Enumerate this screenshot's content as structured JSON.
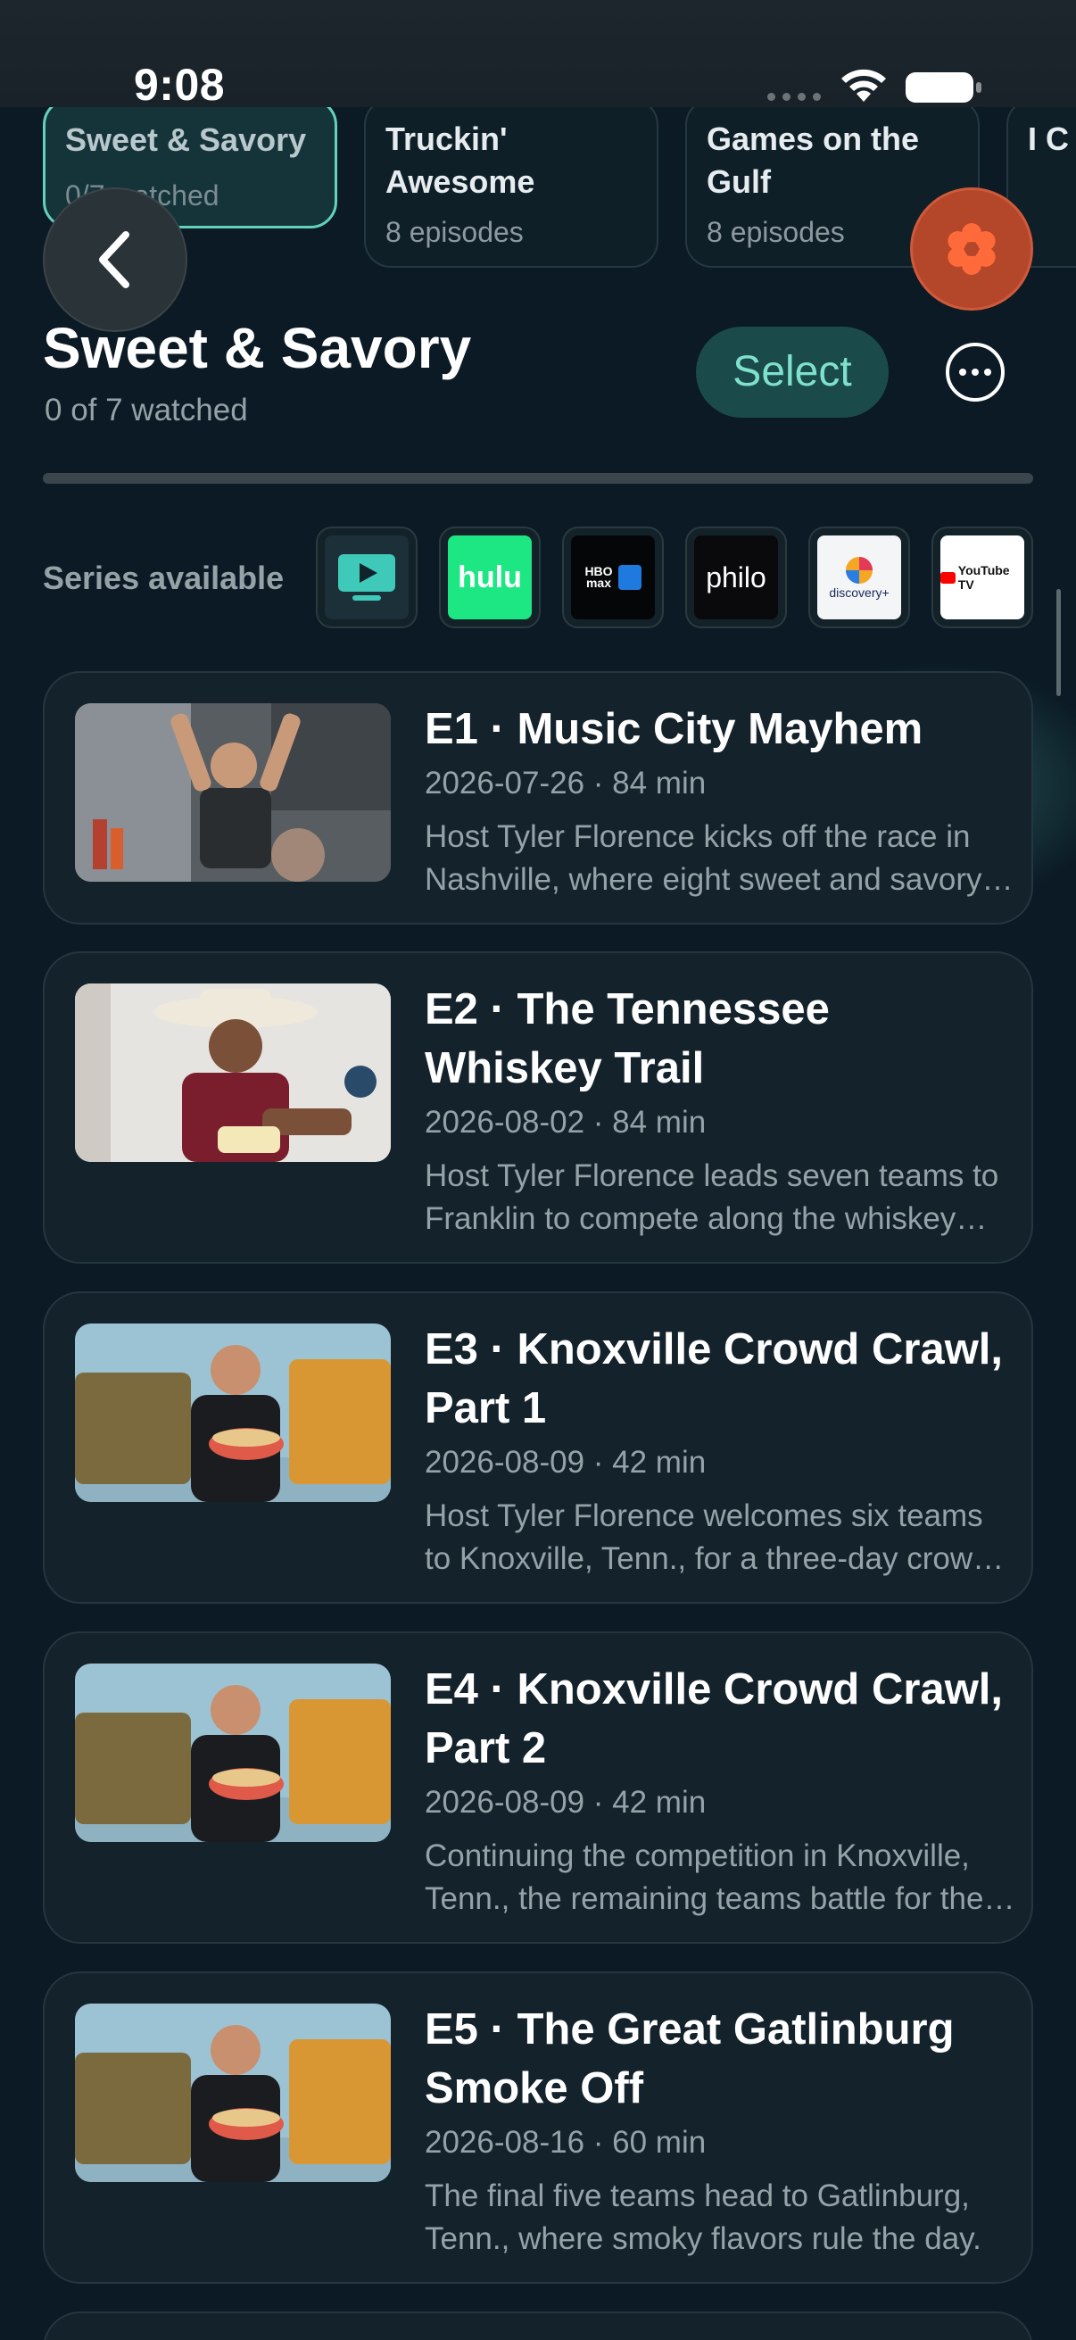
{
  "status": {
    "time": "9:08"
  },
  "seasons": [
    {
      "title": "Sweet & Savory",
      "sub": "0/7 watched"
    },
    {
      "title": "Truckin' Awesome",
      "sub": "8 episodes"
    },
    {
      "title": "Games on the Gulf",
      "sub": "8 episodes"
    },
    {
      "title": "I C",
      "sub": ""
    }
  ],
  "header": {
    "title": "Sweet & Savory",
    "watched": "0 of 7 watched",
    "select_label": "Select"
  },
  "providers": {
    "label": "Series available",
    "items": [
      {
        "name": "tv-app",
        "text": ""
      },
      {
        "name": "hulu",
        "text": "hulu"
      },
      {
        "name": "hbo-max-prime",
        "text": "HBO max · prime video"
      },
      {
        "name": "philo",
        "text": "philo"
      },
      {
        "name": "discovery-plus",
        "text": "discovery+"
      },
      {
        "name": "youtube-tv",
        "text": "YouTube TV"
      }
    ]
  },
  "episodes": [
    {
      "title": "E1 · Music City Mayhem",
      "meta": "2026-07-26 · 84 min",
      "desc": "Host Tyler Florence kicks off the race in Nashville, where eight sweet and savory food trucks compete."
    },
    {
      "title": "E2 · The Tennessee Whiskey Trail",
      "meta": "2026-08-02 · 84 min",
      "desc": "Host Tyler Florence leads seven teams to Franklin to compete along the whiskey trail."
    },
    {
      "title": "E3 · Knoxville Crowd Crawl, Part 1",
      "meta": "2026-08-09 · 42 min",
      "desc": "Host Tyler Florence welcomes six teams to Knoxville, Tenn., for a three-day crowd crawl."
    },
    {
      "title": "E4 · Knoxville Crowd Crawl, Part 2",
      "meta": "2026-08-09 · 42 min",
      "desc": "Continuing the competition in Knoxville, Tenn., the remaining teams battle for the crowd."
    },
    {
      "title": "E5 · The Great Gatlinburg Smoke Off",
      "meta": "2026-08-16 · 60 min",
      "desc": "The final five teams head to Gatlinburg, Tenn., where smoky flavors rule the day."
    }
  ],
  "colors": {
    "accent": "#63d1bd",
    "background": "#0b1a24",
    "card": "#13222b",
    "flower": "#b4462a"
  }
}
